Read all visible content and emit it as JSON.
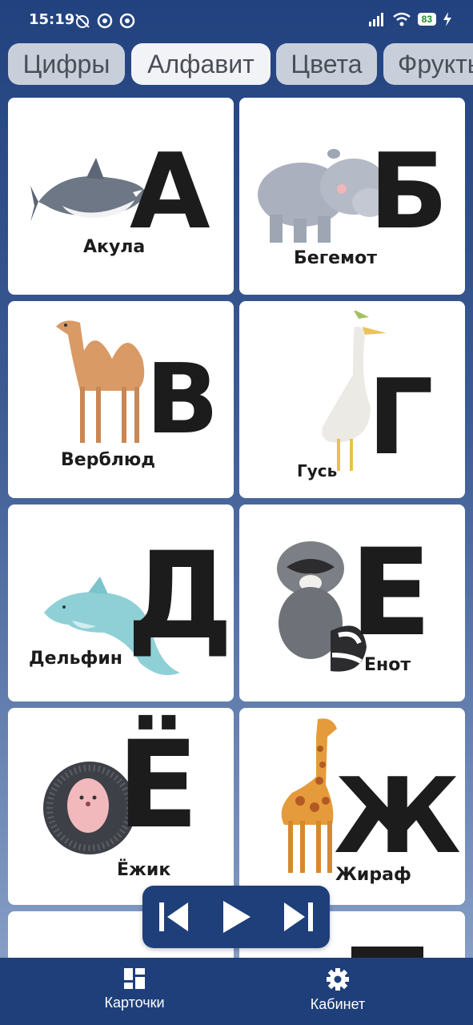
{
  "status": {
    "time": "15:19",
    "battery": "83"
  },
  "tabs": [
    {
      "label": "Цифры"
    },
    {
      "label": "Алфавит",
      "active": true
    },
    {
      "label": "Цвета"
    },
    {
      "label": "Фрукты"
    }
  ],
  "cards": [
    {
      "letter": "А",
      "name": "Акула",
      "icon": "shark-illustration"
    },
    {
      "letter": "Б",
      "name": "Бегемот",
      "icon": "hippo-illustration"
    },
    {
      "letter": "В",
      "name": "Верблюд",
      "icon": "camel-illustration"
    },
    {
      "letter": "Г",
      "name": "Гусь",
      "icon": "goose-illustration"
    },
    {
      "letter": "Д",
      "name": "Дельфин",
      "icon": "dolphin-illustration"
    },
    {
      "letter": "Е",
      "name": "Енот",
      "icon": "raccoon-illustration"
    },
    {
      "letter": "Ё",
      "name": "Ёжик",
      "icon": "hedgehog-illustration"
    },
    {
      "letter": "Ж",
      "name": "Жираф",
      "icon": "giraffe-illustration"
    }
  ],
  "player": {
    "prev_icon": "skip-previous-icon",
    "play_icon": "play-icon",
    "next_icon": "skip-next-icon"
  },
  "bottom_nav": [
    {
      "label": "Карточки",
      "icon": "grid-icon"
    },
    {
      "label": "Кабинет",
      "icon": "gear-icon"
    }
  ],
  "colors": {
    "nav_bg": "#1f3f7a",
    "tab_bg": "#c8cfdb",
    "tab_active_bg": "#f2f3f6"
  }
}
